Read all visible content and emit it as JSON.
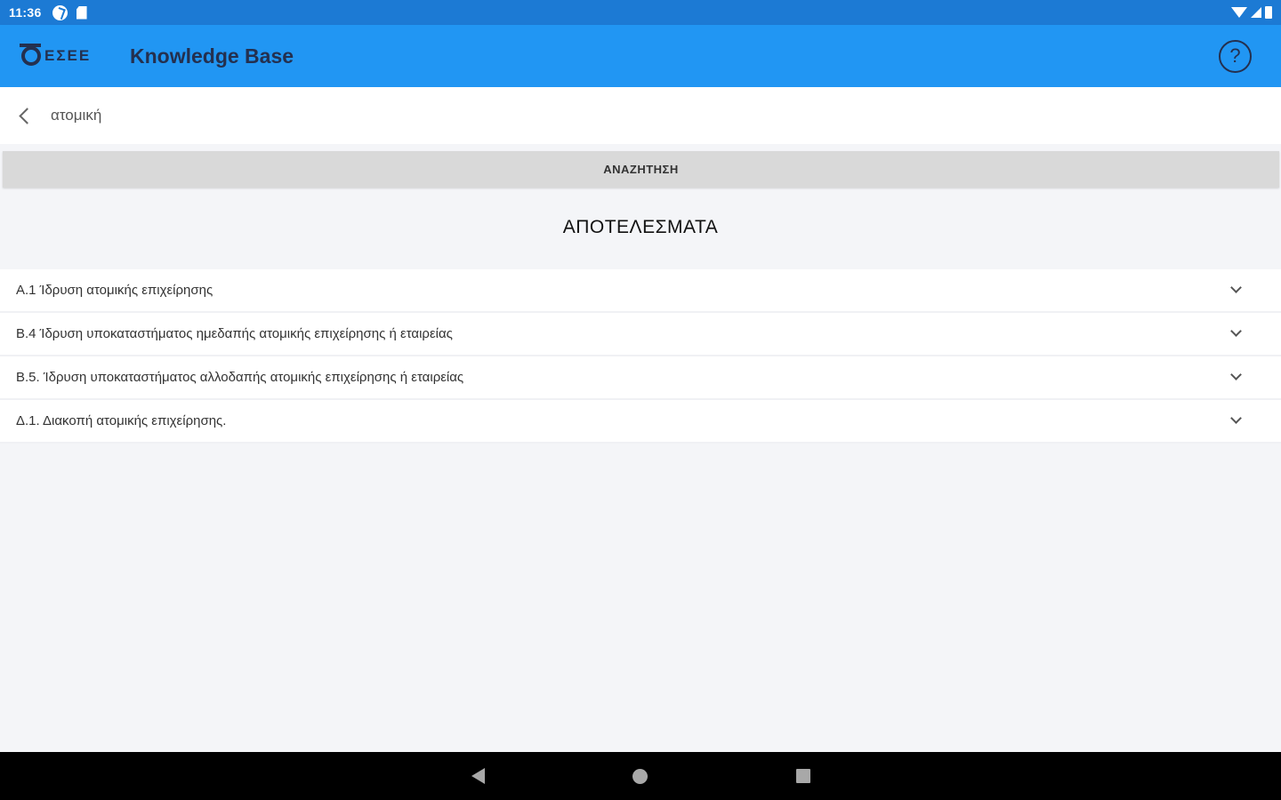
{
  "status_bar": {
    "time": "11:36",
    "icons": [
      "sync-icon",
      "sd-card-icon",
      "wifi-icon",
      "signal-icon",
      "battery-icon"
    ]
  },
  "app_bar": {
    "logo_text": "ΕΣΕΕ",
    "title": "Knowledge Base",
    "help_icon_glyph": "?"
  },
  "breadcrumb": {
    "text": "ατομική"
  },
  "search_button": {
    "label": "ΑΝΑΖΗΤΗΣΗ"
  },
  "results": {
    "title": "ΑΠΟΤΕΛΕΣΜΑΤΑ",
    "items": [
      {
        "label": "Α.1 Ίδρυση ατομικής επιχείρησης"
      },
      {
        "label": "Β.4 Ίδρυση υποκαταστήματος ημεδαπής ατομικής επιχείρησης ή εταιρείας"
      },
      {
        "label": "Β.5. Ίδρυση υποκαταστήματος αλλοδαπής ατομικής επιχείρησης ή εταιρείας"
      },
      {
        "label": "Δ.1. Διακοπή ατομικής επιχείρησης."
      }
    ]
  },
  "colors": {
    "status_bar": "#1c7ad4",
    "app_bar": "#2196f3",
    "app_text": "#24304f",
    "background": "#f4f5f8"
  }
}
